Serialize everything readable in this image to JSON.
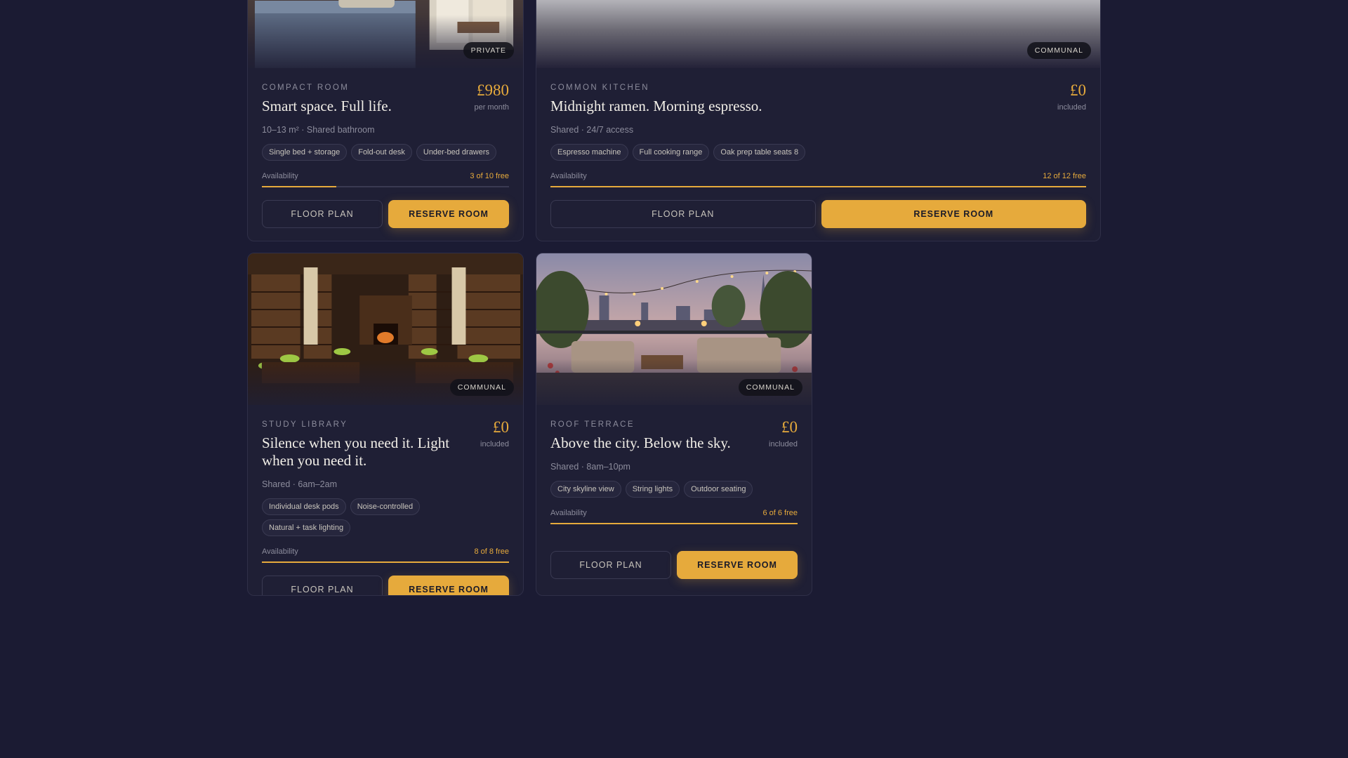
{
  "colors": {
    "background": "#1b1b33",
    "card": "#1f1f35",
    "accent": "#e6aa3c",
    "muted": "#8c8c9c"
  },
  "cards": [
    {
      "image": "bedroom-photo",
      "badge": "PRIVATE",
      "eyebrow": "COMPACT ROOM",
      "title": "Smart space. Full life.",
      "price": "£980",
      "price_sub": "per month",
      "meta": "10–13 m² · Shared bathroom",
      "tags": [
        "Single bed + storage",
        "Fold-out desk",
        "Under-bed drawers"
      ],
      "availability_label": "Availability",
      "availability_text": "3 of 10 free",
      "availability_fraction": 0.3,
      "floor_plan_label": "FLOOR PLAN",
      "reserve_label": "RESERVE ROOM"
    },
    {
      "image": "kitchen-photo",
      "badge": "COMMUNAL",
      "eyebrow": "COMMON KITCHEN",
      "title": "Midnight ramen. Morning espresso.",
      "price": "£0",
      "price_sub": "included",
      "meta": "Shared · 24/7 access",
      "tags": [
        "Espresso machine",
        "Full cooking range",
        "Oak prep table seats 8"
      ],
      "availability_label": "Availability",
      "availability_text": "12 of 12 free",
      "availability_fraction": 1.0,
      "floor_plan_label": "FLOOR PLAN",
      "reserve_label": "RESERVE ROOM"
    },
    {
      "image": "library-photo",
      "badge": "COMMUNAL",
      "eyebrow": "STUDY LIBRARY",
      "title": "Silence when you need it. Light when you need it.",
      "price": "£0",
      "price_sub": "included",
      "meta": "Shared · 6am–2am",
      "tags": [
        "Individual desk pods",
        "Noise-controlled",
        "Natural + task lighting"
      ],
      "availability_label": "Availability",
      "availability_text": "8 of 8 free",
      "availability_fraction": 1.0,
      "floor_plan_label": "FLOOR PLAN",
      "reserve_label": "RESERVE ROOM"
    },
    {
      "image": "terrace-photo",
      "badge": "COMMUNAL",
      "eyebrow": "ROOF TERRACE",
      "title": "Above the city. Below the sky.",
      "price": "£0",
      "price_sub": "included",
      "meta": "Shared · 8am–10pm",
      "tags": [
        "City skyline view",
        "String lights",
        "Outdoor seating"
      ],
      "availability_label": "Availability",
      "availability_text": "6 of 6 free",
      "availability_fraction": 1.0,
      "floor_plan_label": "FLOOR PLAN",
      "reserve_label": "RESERVE ROOM"
    }
  ]
}
